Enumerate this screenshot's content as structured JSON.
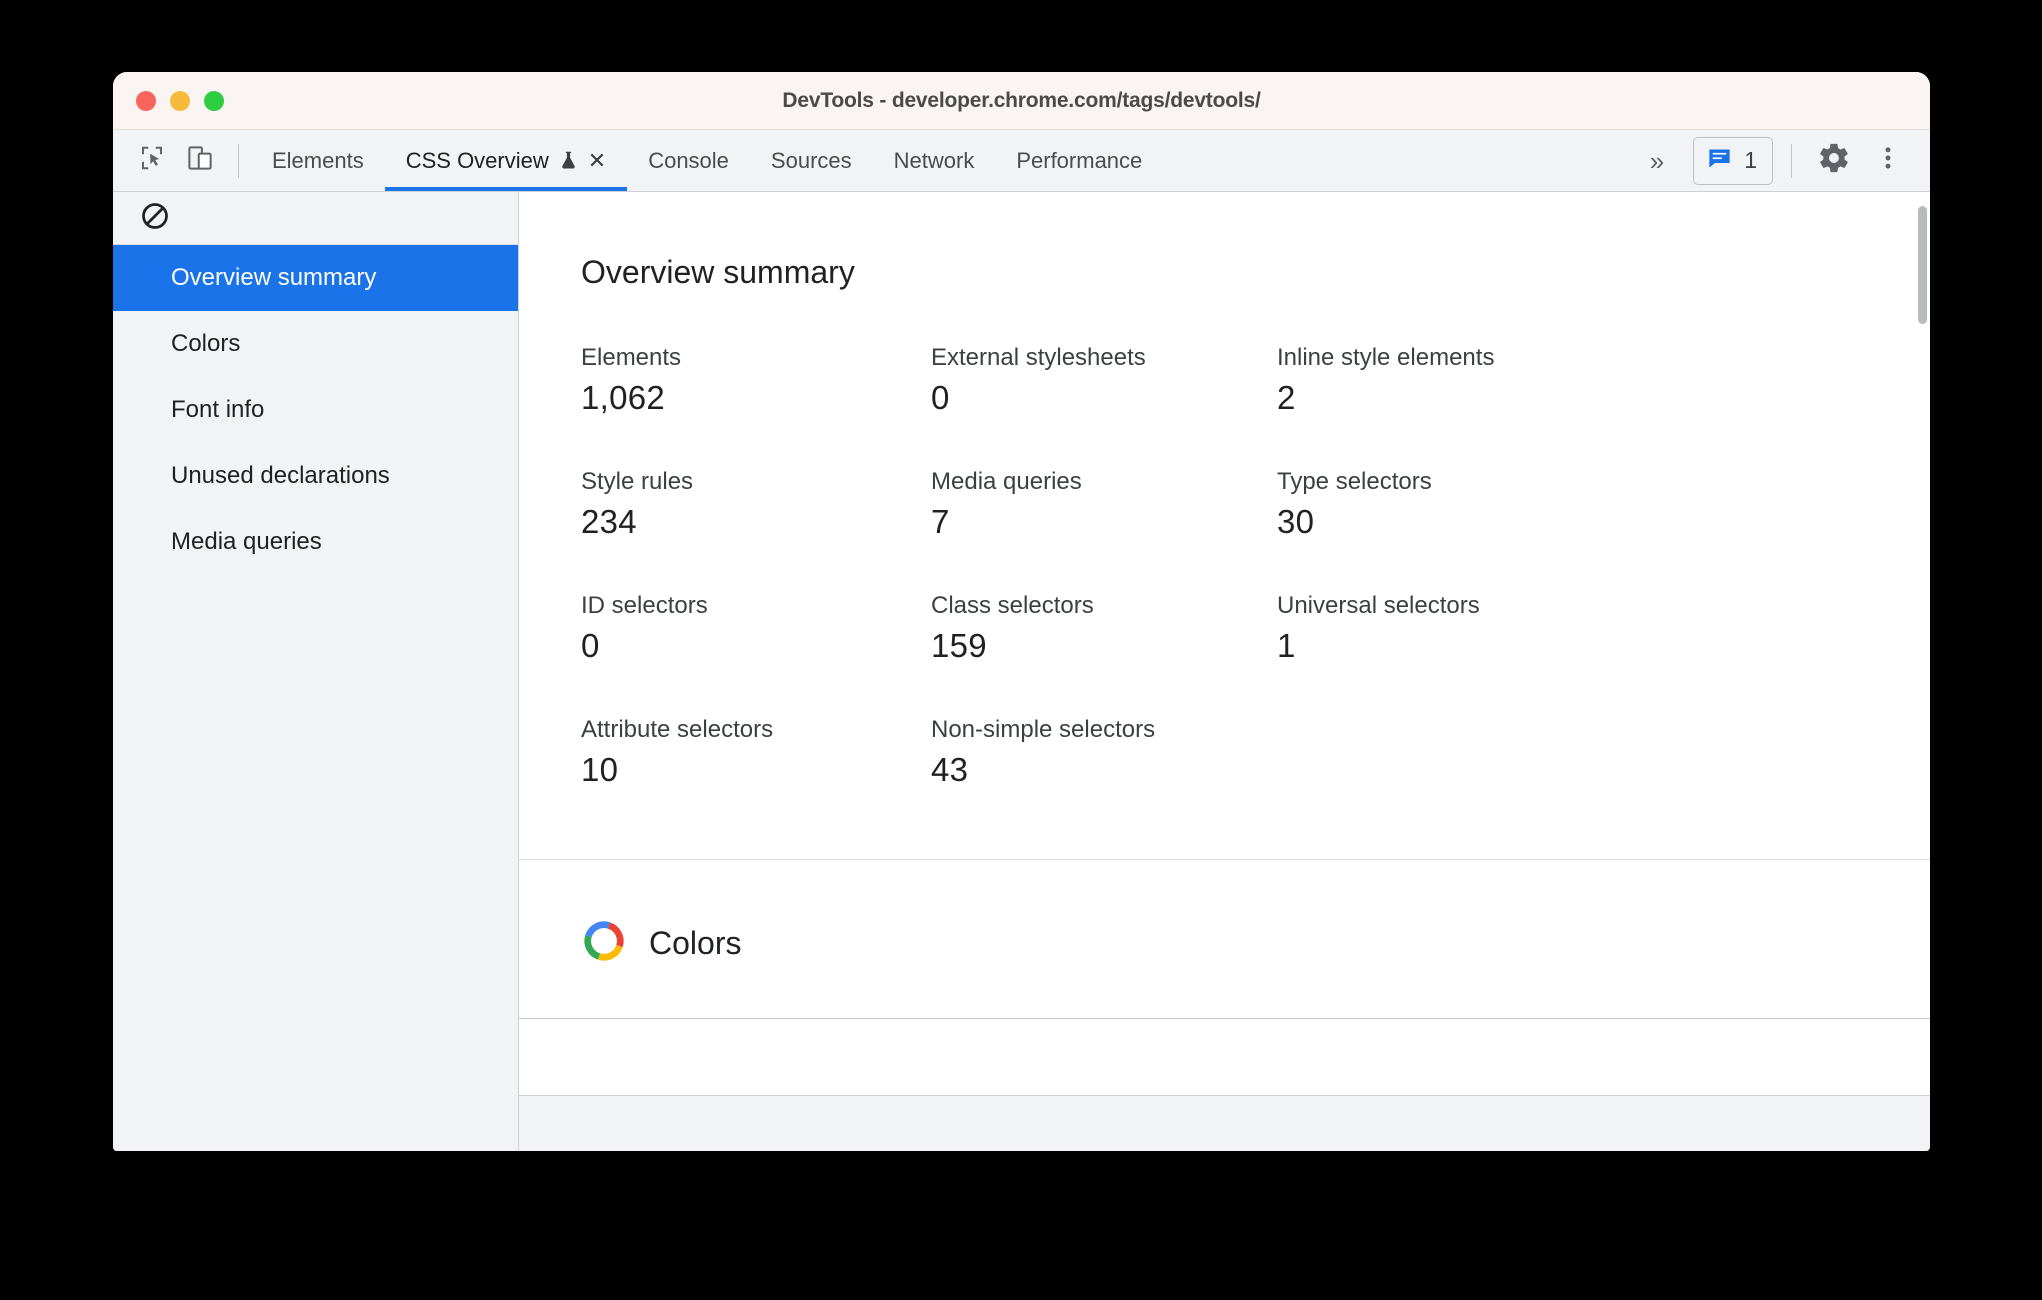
{
  "window": {
    "title": "DevTools - developer.chrome.com/tags/devtools/",
    "traffic_lights": [
      "close",
      "minimize",
      "maximize"
    ],
    "accent_color": "#1a73e8"
  },
  "toolbar": {
    "inspect_icon": "inspect-cursor-icon",
    "device_toolbar_icon": "device-toolbar-icon",
    "tabs": [
      {
        "label": "Elements",
        "active": false,
        "closable": false
      },
      {
        "label": "CSS Overview",
        "active": true,
        "closable": true,
        "experiment_icon": "flask-icon",
        "close_icon": "close-icon"
      },
      {
        "label": "Console",
        "active": false,
        "closable": false
      },
      {
        "label": "Sources",
        "active": false,
        "closable": false
      },
      {
        "label": "Network",
        "active": false,
        "closable": false
      },
      {
        "label": "Performance",
        "active": false,
        "closable": false
      }
    ],
    "overflow_label": "»",
    "issues": {
      "icon": "issues-message-icon",
      "count": "1",
      "color": "#1a73e8"
    },
    "settings_icon": "gear-icon",
    "more_icon": "three-dot-menu-icon"
  },
  "sidebar": {
    "clear_icon": "clear-no-entry-icon",
    "items": [
      {
        "label": "Overview summary",
        "selected": true
      },
      {
        "label": "Colors",
        "selected": false
      },
      {
        "label": "Font info",
        "selected": false
      },
      {
        "label": "Unused declarations",
        "selected": false
      },
      {
        "label": "Media queries",
        "selected": false
      }
    ]
  },
  "main": {
    "panel_title": "Overview summary",
    "stats": [
      {
        "label": "Elements",
        "value": "1,062"
      },
      {
        "label": "External stylesheets",
        "value": "0"
      },
      {
        "label": "Inline style elements",
        "value": "2"
      },
      {
        "label": "Style rules",
        "value": "234"
      },
      {
        "label": "Media queries",
        "value": "7"
      },
      {
        "label": "Type selectors",
        "value": "30"
      },
      {
        "label": "ID selectors",
        "value": "0"
      },
      {
        "label": "Class selectors",
        "value": "159"
      },
      {
        "label": "Universal selectors",
        "value": "1"
      },
      {
        "label": "Attribute selectors",
        "value": "10"
      },
      {
        "label": "Non-simple selectors",
        "value": "43"
      }
    ],
    "colors_section": {
      "title": "Colors",
      "icon": "color-wheel-icon",
      "wheel_colors": [
        "#4285f4",
        "#34a853",
        "#fbbc05",
        "#ea4335"
      ]
    }
  }
}
